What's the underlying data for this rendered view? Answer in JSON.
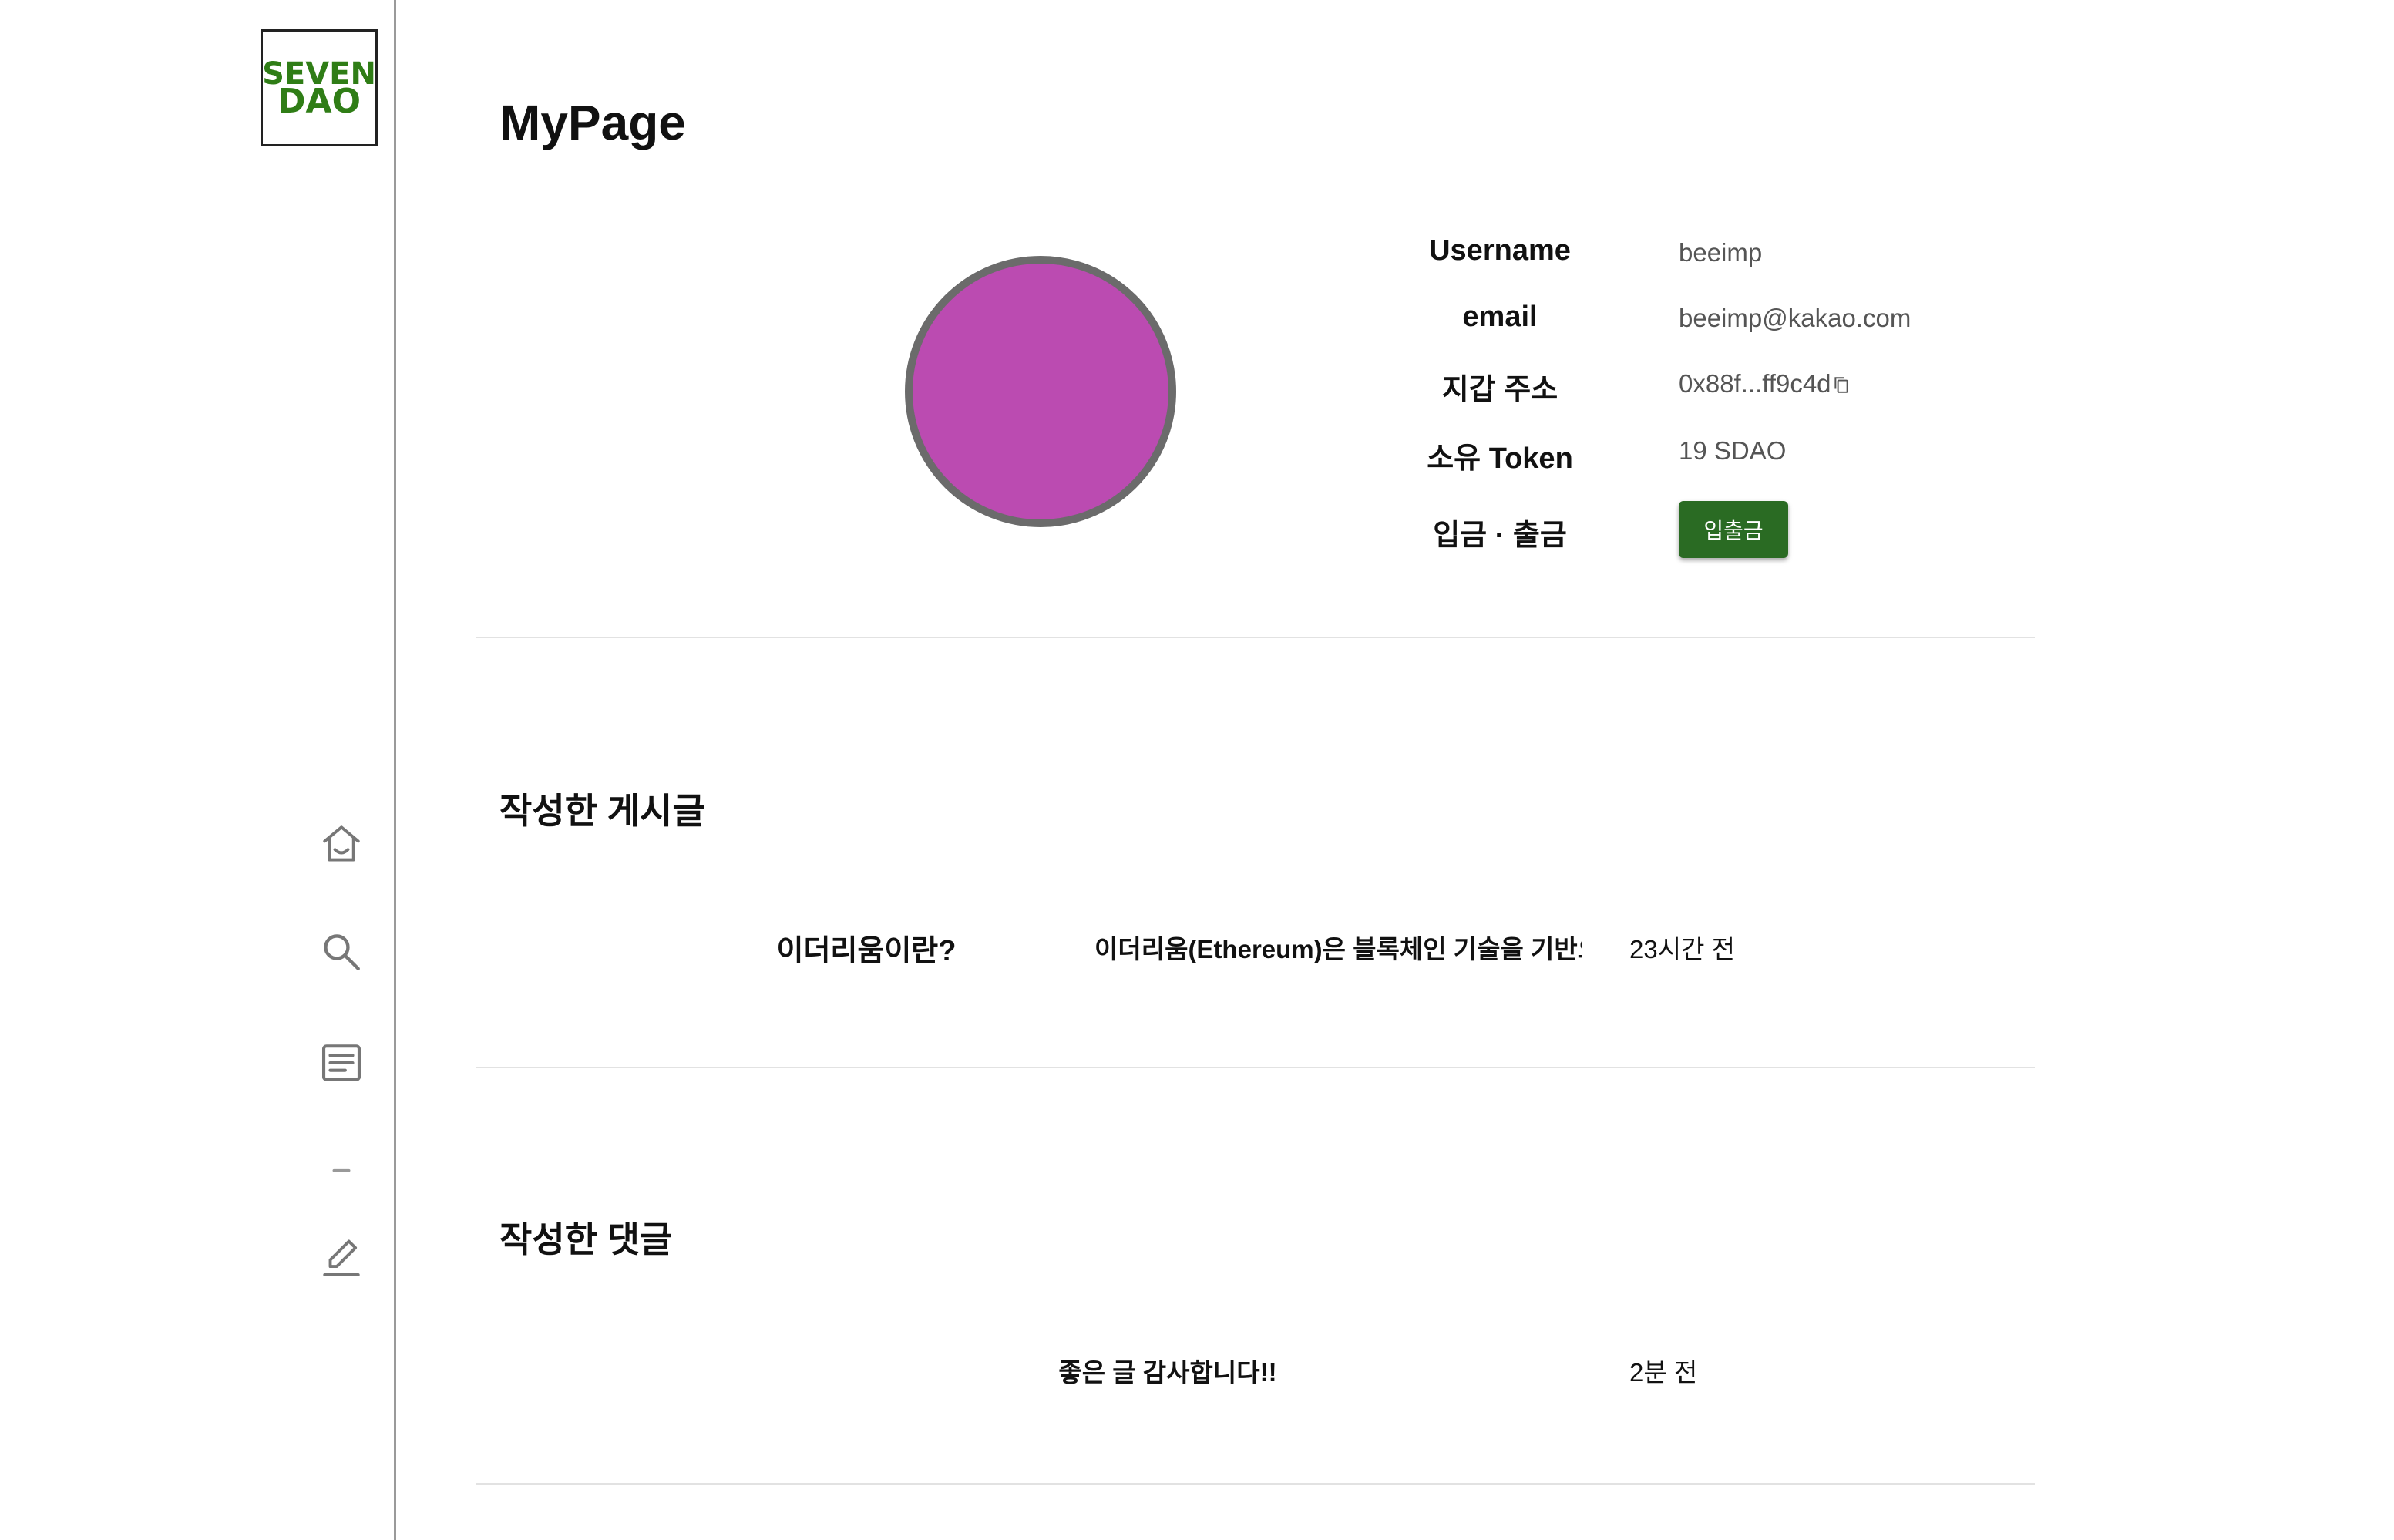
{
  "logo": {
    "line1": "SEVEN",
    "line2": "DAO",
    "color": "#2f7d16"
  },
  "sidebar": {
    "icons": [
      "home-icon",
      "search-icon",
      "board-icon",
      "minus-icon",
      "edit-icon"
    ]
  },
  "page": {
    "title": "MyPage"
  },
  "profile": {
    "avatar_color": "#bb4bb1",
    "username_label": "Username",
    "username": "beeimp",
    "email_label": "email",
    "email": "beeimp@kakao.com",
    "wallet_label": "지갑 주소",
    "wallet": "0x88f...ff9c4d",
    "token_label": "소유 Token",
    "token": "19 SDAO",
    "deposit_label": "입금 · 출금",
    "deposit_button": "입출금",
    "button_color": "#2a6b23"
  },
  "posts": {
    "title": "작성한 게시글",
    "items": [
      {
        "title": "이더리움이란?",
        "body": "이더리움(Ethereum)은 블록체인 기술을 기반으로",
        "time": "23시간 전"
      }
    ]
  },
  "comments": {
    "title": "작성한 댓글",
    "items": [
      {
        "text": "좋은 글 감사합니다!!",
        "time": "2분 전"
      }
    ]
  }
}
